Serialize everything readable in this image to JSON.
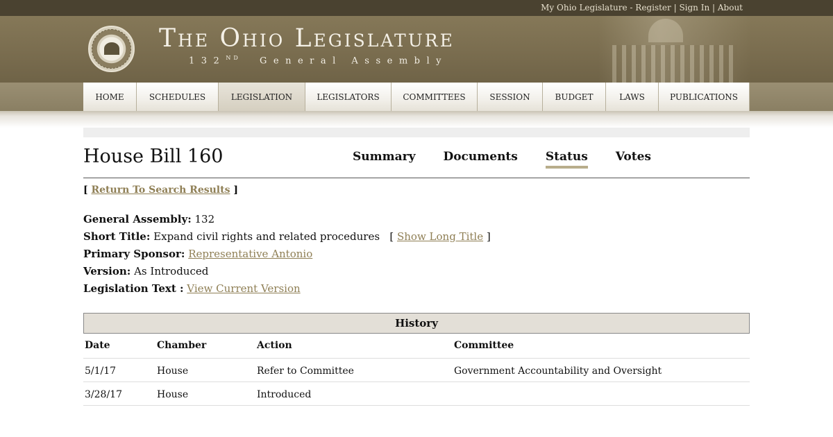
{
  "top_links": {
    "my_ohio": "My Ohio Legislature",
    "dash": " - ",
    "register": "Register",
    "sign_in": "Sign In",
    "about": "About",
    "sep": " | "
  },
  "banner": {
    "title": "The Ohio Legislature",
    "subtitle_num": "132",
    "subtitle_sup": "ND",
    "subtitle_rest": "General Assembly"
  },
  "nav": [
    {
      "label": "Home",
      "active": false
    },
    {
      "label": "Schedules",
      "active": false
    },
    {
      "label": "Legislation",
      "active": true
    },
    {
      "label": "Legislators",
      "active": false
    },
    {
      "label": "Committees",
      "active": false
    },
    {
      "label": "Session",
      "active": false
    },
    {
      "label": "Budget",
      "active": false
    },
    {
      "label": "Laws",
      "active": false
    },
    {
      "label": "Publications",
      "active": false
    }
  ],
  "bill": {
    "title": "House Bill 160",
    "tabs": [
      {
        "label": "Summary",
        "active": false
      },
      {
        "label": "Documents",
        "active": false
      },
      {
        "label": "Status",
        "active": true
      },
      {
        "label": "Votes",
        "active": false
      }
    ],
    "return_open": "[ ",
    "return_link": "Return To Search Results",
    "return_close": " ]"
  },
  "fields": {
    "ga_label": "General Assembly:",
    "ga_value": "132",
    "short_title_label": "Short Title:",
    "short_title_value": "Expand civil rights and related procedures",
    "show_long_open": "[",
    "show_long_link": "Show Long Title",
    "show_long_close": "]",
    "sponsor_label": "Primary Sponsor:",
    "sponsor_value": "Representative Antonio",
    "version_label": "Version:",
    "version_value": "As Introduced",
    "text_label": "Legislation Text :",
    "text_value": "View Current Version"
  },
  "history": {
    "title": "History",
    "columns": [
      "Date",
      "Chamber",
      "Action",
      "Committee"
    ],
    "rows": [
      [
        "5/1/17",
        "House",
        "Refer to Committee",
        "Government Accountability and Oversight"
      ],
      [
        "3/28/17",
        "House",
        "Introduced",
        ""
      ]
    ]
  },
  "colors": {
    "banner": "#7a6d4f",
    "link": "#8f7f55",
    "tab_underline": "#b8ad8b"
  }
}
